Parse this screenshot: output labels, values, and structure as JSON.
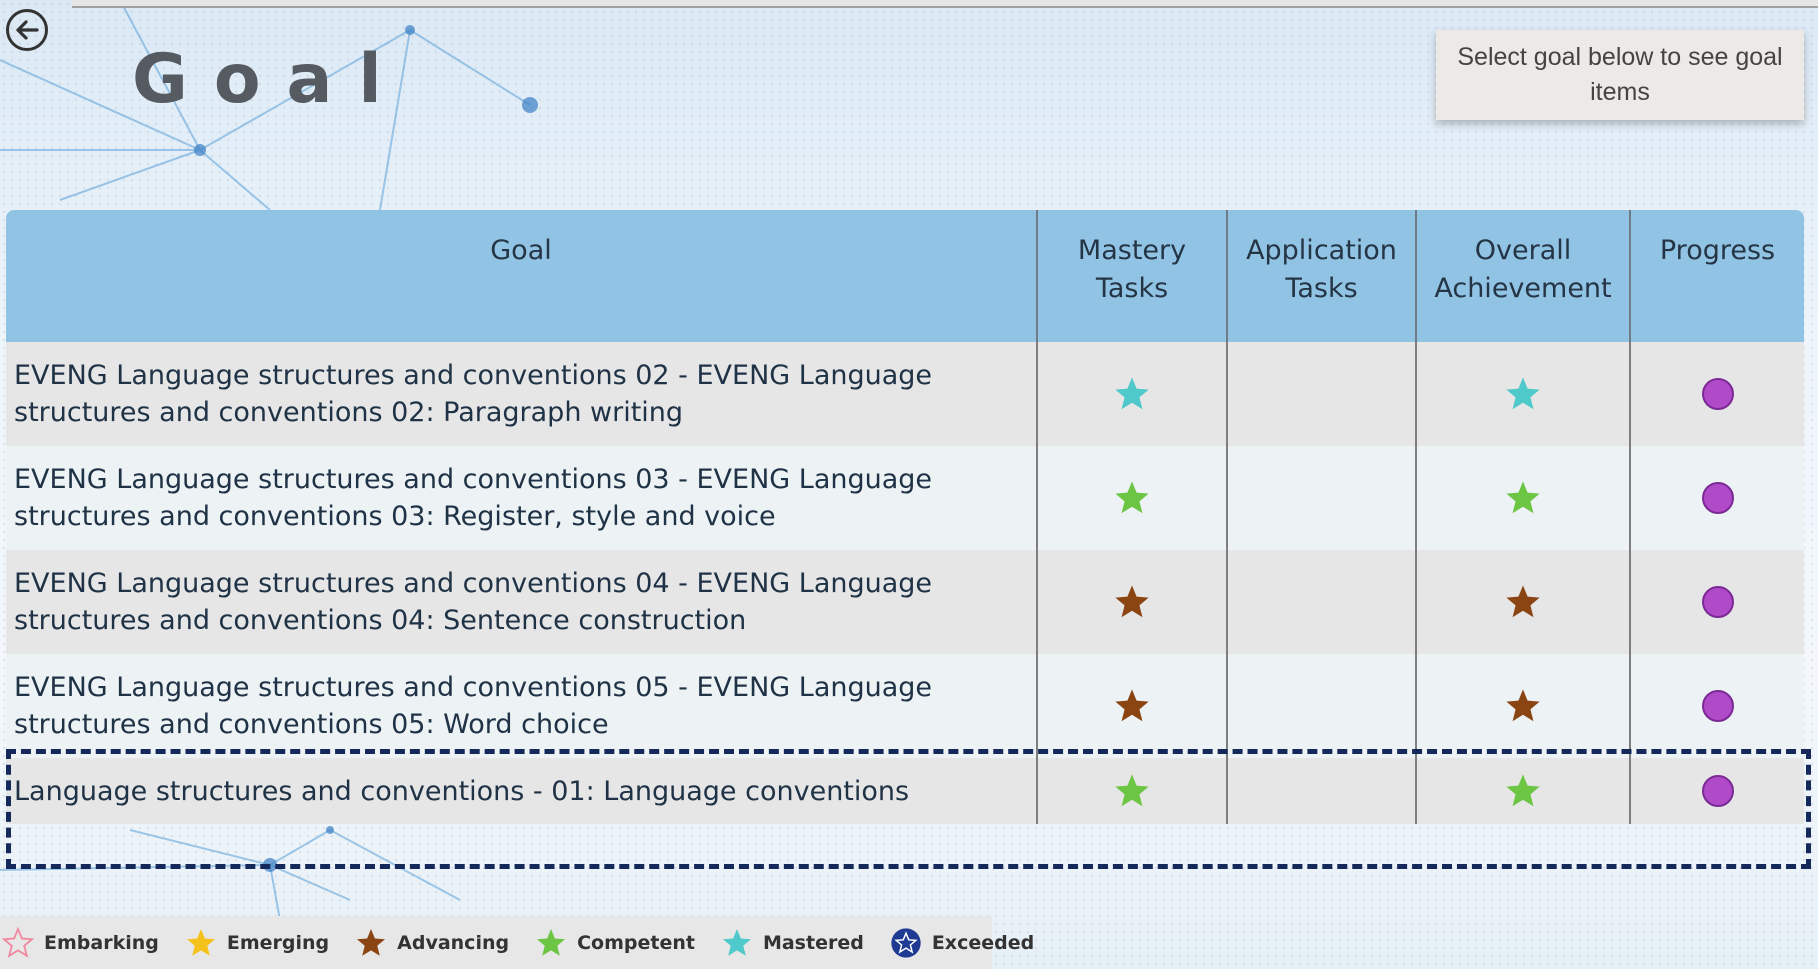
{
  "page": {
    "title": "Goal",
    "hint": "Select goal below to see goal items"
  },
  "table": {
    "headers": {
      "goal": "Goal",
      "mastery": "Mastery Tasks",
      "application": "Application Tasks",
      "overall": "Overall Achievement",
      "progress": "Progress"
    },
    "rows": [
      {
        "goal": "EVENG Language structures and conventions 02 - EVENG Language structures and conventions 02: Paragraph writing",
        "mastery": "Mastered",
        "application": "",
        "overall": "Mastered",
        "progress": "circle"
      },
      {
        "goal": "EVENG Language structures and conventions 03 - EVENG Language structures and conventions 03: Register, style and voice",
        "mastery": "Competent",
        "application": "",
        "overall": "Competent",
        "progress": "circle"
      },
      {
        "goal": "EVENG Language structures and conventions 04 - EVENG Language structures and conventions 04: Sentence construction",
        "mastery": "Advancing",
        "application": "",
        "overall": "Advancing",
        "progress": "circle",
        "selected": true
      },
      {
        "goal": "EVENG Language structures and conventions 05 - EVENG Language structures and conventions 05: Word choice",
        "mastery": "Advancing",
        "application": "",
        "overall": "Advancing",
        "progress": "circle"
      },
      {
        "goal": "Language structures and conventions - 01: Language conventions",
        "mastery": "Competent",
        "application": "",
        "overall": "Competent",
        "progress": "circle"
      }
    ]
  },
  "legend": [
    {
      "label": "Embarking",
      "color": "#f08aa0",
      "style": "outline"
    },
    {
      "label": "Emerging",
      "color": "#f5c21b",
      "style": "filled"
    },
    {
      "label": "Advancing",
      "color": "#8b4513",
      "style": "filled"
    },
    {
      "label": "Competent",
      "color": "#6cc644",
      "style": "filled"
    },
    {
      "label": "Mastered",
      "color": "#4fc9c9",
      "style": "filled"
    },
    {
      "label": "Exceeded",
      "color": "#1f3a93",
      "style": "badge"
    }
  ],
  "colors": {
    "header_bg": "#91c4e4",
    "progress_dot": "#b14ac8",
    "selection_outline": "#14285a"
  }
}
